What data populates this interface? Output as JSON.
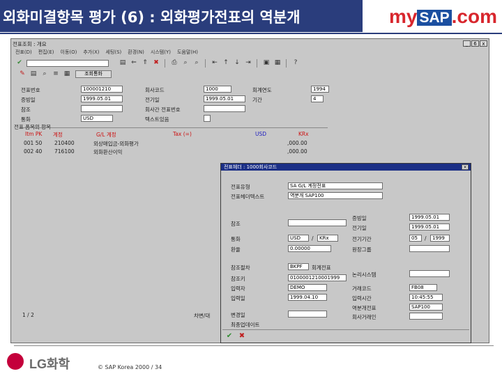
{
  "header": {
    "title": "외화미결항목 평가 (6) : 외화평가전표의 역분개",
    "logo_my": "my",
    "logo_sap": "SAP",
    "logo_com": ".com"
  },
  "window": {
    "title": "전표조회 : 개요",
    "controls": [
      "_",
      "6",
      "x"
    ],
    "menu": [
      "전표(D)",
      "편집(E)",
      "이동(O)",
      "추가(X)",
      "세팅(S)",
      "환경(N)",
      "시스템(Y)",
      "도움말(H)"
    ],
    "toolbar_button": "조회통화"
  },
  "form": {
    "doc_no_label": "전표번호",
    "doc_no": "100001210",
    "company_label": "회사코드",
    "company": "1000",
    "fiscal_year_label": "회계연도",
    "fiscal_year": "1994",
    "post_date_label": "증빙일",
    "post_date": "1999.05.01",
    "entry_date_label": "전기일",
    "entry_date": "1999.05.01",
    "period_label": "기간",
    "period": "4",
    "ref_label": "참조",
    "intercompany_label": "회사간 전표번호",
    "currency_label": "통화",
    "currency": "USD",
    "texts_label": "텍스트있음"
  },
  "items": {
    "section_label": "전표 품목의 항목",
    "headers": [
      "Itm PK",
      "계정",
      "G/L 계정",
      "Tax (=)",
      "USD",
      "KRx"
    ],
    "rows": [
      {
        "itm": "001 50",
        "account": "210400",
        "desc": "외상매입금-외화평가",
        "amount": ",000.00"
      },
      {
        "itm": "002 40",
        "account": "716100",
        "desc": "외화환산이익",
        "amount": ",000.00"
      }
    ],
    "page": "1 / 2",
    "side_label": "차변/대"
  },
  "popup": {
    "title": "전표헤더 : 1000회사코드",
    "doc_type_label": "전표유형",
    "doc_type": "SA G/L 계정전표",
    "header_text_label": "전표헤더텍스트",
    "header_text": "역분개 SAP100",
    "ref_label": "참조",
    "doc_date_label": "증빙일",
    "doc_date": "1999.05.01",
    "post_date_label": "전기일",
    "post_date": "1999.05.01",
    "currency_label": "통화",
    "currency": "USD",
    "currency2": "KRx",
    "period_label": "전기기간",
    "period": "05",
    "period_year": "1999",
    "rate_label": "환율",
    "rate": "0.00000",
    "ledger_label": "원장그룹",
    "ref_tx_label": "참조절차",
    "ref_tx": "BKPF",
    "ref_tx_text": "회계전표",
    "logical_sys_label": "논리시스템",
    "ref_key_label": "참조키",
    "ref_key": "0100001210001999",
    "user_label": "입력자",
    "user": "DEMO",
    "tcode_label": "거래코드",
    "tcode": "FB08",
    "entry_date_label": "입력일",
    "entry_date": "1999.04.10",
    "entry_time_label": "입력시간",
    "entry_time": "10:45:55",
    "reversal_label": "역분개전표",
    "reversal": "SAP100",
    "change_label": "변경일",
    "last_update_label": "최종업데이트",
    "trading_label": "회사거래인"
  },
  "footer": {
    "brand": "LG화학",
    "copyright": "©  SAP Korea 2000  /  34"
  },
  "colors": {
    "title_bar": "#2a3d7c",
    "sap_blue": "#1b4fa0",
    "brand_red": "#c4003b"
  }
}
